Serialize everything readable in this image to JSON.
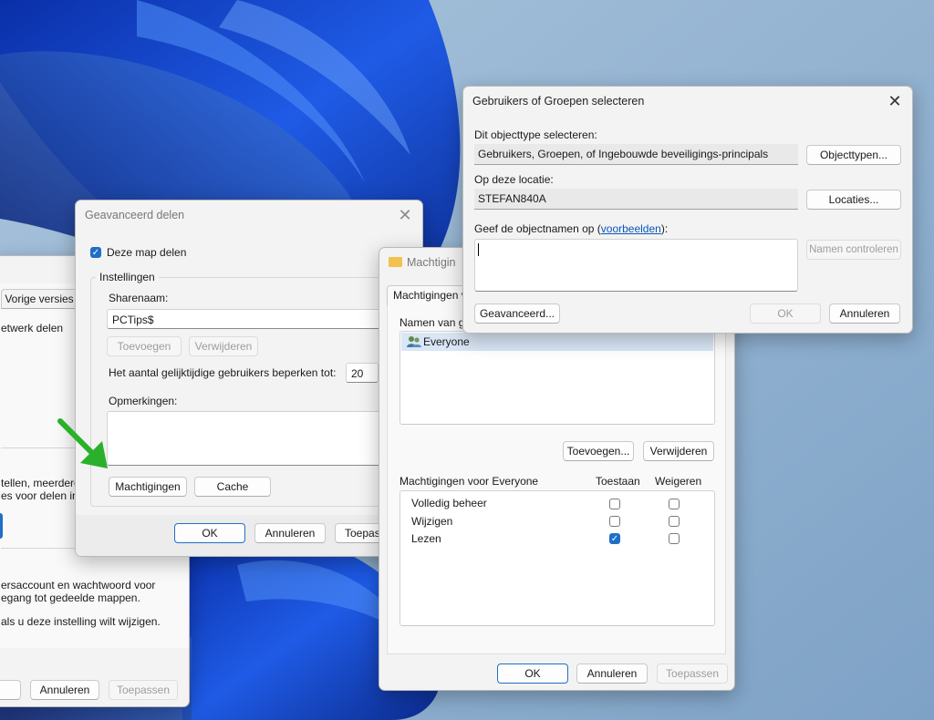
{
  "colors": {
    "accent": "#1f6fc7",
    "arrow": "#2bb02b",
    "wallpaper_blue": "#1e4fd6"
  },
  "back_window": {
    "tab_label": "Vorige versies",
    "text_network": "etwerk delen",
    "text_settings_1": "tellen, meerdere",
    "text_settings_2": "es voor delen in",
    "text_account_1": "ersaccount en wachtwoord voor",
    "text_account_2": "egang tot gedeelde mappen.",
    "text_change": "als u deze instelling wilt wijzigen.",
    "cancel_label": "Annuleren",
    "apply_label": "Toepassen"
  },
  "advanced_sharing": {
    "title": "Geavanceerd delen",
    "share_checkbox_label": "Deze map delen",
    "share_checked": true,
    "settings_group": "Instellingen",
    "share_name_label": "Sharenaam:",
    "share_name_value": "PCTips$",
    "add_label": "Toevoegen",
    "remove_label": "Verwijderen",
    "limit_label": "Het aantal gelijktijdige gebruikers beperken tot:",
    "limit_value": "20",
    "comments_label": "Opmerkingen:",
    "permissions_button": "Machtigingen",
    "cache_button": "Cache",
    "ok_label": "OK",
    "cancel_label": "Annuleren",
    "apply_label": "Toepas"
  },
  "permissions_window": {
    "title": "Machtigin",
    "tab_label": "Machtigingen v",
    "names_label": "Namen van g",
    "group_entry": "Everyone",
    "add_label": "Toevoegen...",
    "remove_label": "Verwijderen",
    "perms_label": "Machtigingen voor Everyone",
    "allow_header": "Toestaan",
    "deny_header": "Weigeren",
    "permissions": [
      {
        "name": "Volledig beheer",
        "allow": false,
        "deny": false
      },
      {
        "name": "Wijzigen",
        "allow": false,
        "deny": false
      },
      {
        "name": "Lezen",
        "allow": true,
        "deny": false
      }
    ],
    "ok_label": "OK",
    "cancel_label": "Annuleren",
    "apply_label": "Toepassen"
  },
  "select_users": {
    "title": "Gebruikers of Groepen selecteren",
    "object_type_label": "Dit objecttype selecteren:",
    "object_type_value": "Gebruikers, Groepen, of Ingebouwde beveiligings-principals",
    "object_types_button": "Objecttypen...",
    "location_label": "Op deze locatie:",
    "location_value": "STEFAN840A",
    "locations_button": "Locaties...",
    "names_label_prefix": "Geef de objectnamen op (",
    "names_label_link": "voorbeelden",
    "names_label_suffix": "):",
    "check_names_button": "Namen controleren",
    "advanced_button": "Geavanceerd...",
    "ok_label": "OK",
    "cancel_label": "Annuleren"
  }
}
